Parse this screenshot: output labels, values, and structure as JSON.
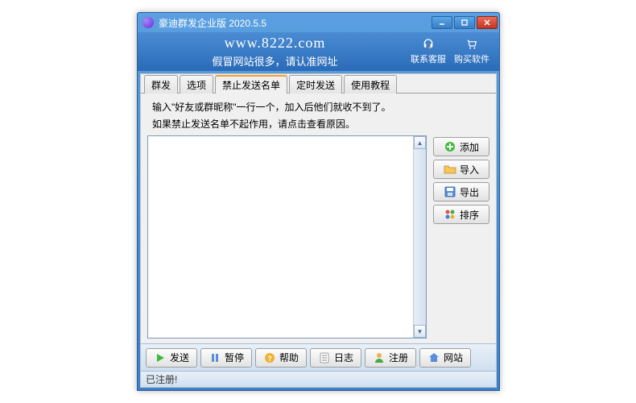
{
  "window": {
    "title": "豪迪群发企业版 2020.5.5"
  },
  "header": {
    "url": "www.8222.com",
    "tagline": "假冒网站很多，请认准网址",
    "support_label": "联系客服",
    "buy_label": "购买软件"
  },
  "tabs": [
    "群发",
    "选项",
    "禁止发送名单",
    "定时发送",
    "使用教程"
  ],
  "active_tab": 2,
  "blocklist": {
    "instr1": "输入\"好友或群昵称\"一行一个，加入后他们就收不到了。",
    "instr2": "如果禁止发送名单不起作用，请点击查看原因。",
    "textarea_value": ""
  },
  "side_buttons": {
    "add": "添加",
    "import": "导入",
    "export": "导出",
    "sort": "排序"
  },
  "bottom_buttons": {
    "send": "发送",
    "pause": "暂停",
    "help": "帮助",
    "log": "日志",
    "register": "注册",
    "website": "网站"
  },
  "status": "已注册!"
}
